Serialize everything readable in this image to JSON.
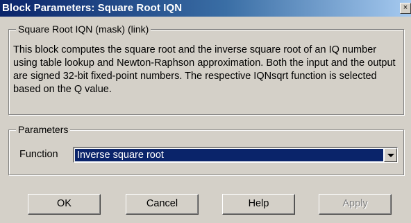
{
  "window": {
    "title": "Block Parameters: Square Root IQN",
    "close_glyph": "×"
  },
  "description": {
    "group_label": "Square Root IQN (mask) (link)",
    "text": "This block computes the square root and the inverse square root of an IQ number using table lookup and Newton-Raphson approximation. Both the input and the output are signed 32-bit fixed-point numbers. The respective IQNsqrt function is selected based on the Q value."
  },
  "parameters": {
    "group_label": "Parameters",
    "function_label": "Function",
    "function_value": "Inverse square root"
  },
  "buttons": {
    "ok": "OK",
    "cancel": "Cancel",
    "help": "Help",
    "apply": "Apply"
  },
  "colors": {
    "title_bar": "#0a246a",
    "dialog_bg": "#d4d0c8",
    "selection": "#0a246a"
  }
}
